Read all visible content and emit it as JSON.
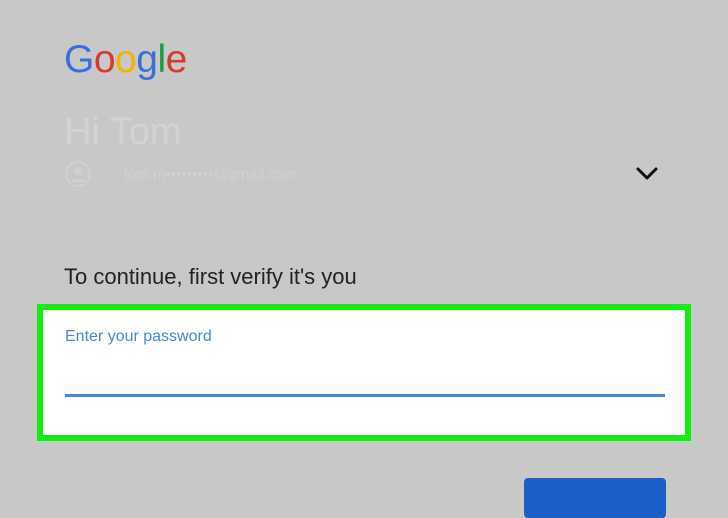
{
  "brand": {
    "logo_letters": [
      {
        "char": "G",
        "color": "#3a6fd9"
      },
      {
        "char": "o",
        "color": "#d93a2b"
      },
      {
        "char": "o",
        "color": "#f2b400"
      },
      {
        "char": "g",
        "color": "#3a6fd9"
      },
      {
        "char": "l",
        "color": "#179b46"
      },
      {
        "char": "e",
        "color": "#d93a2b"
      }
    ]
  },
  "account": {
    "greeting": "Hi Tom",
    "email": "tom.m•••••••••@gmail.com",
    "avatar_icon": "account-circle-icon",
    "switch_icon": "chevron-down-icon"
  },
  "verify": {
    "prompt": "To continue, first verify it's you",
    "password_label": "Enter your password",
    "password_value": ""
  },
  "colors": {
    "background": "#c8c8c8",
    "highlight": "#11ee11",
    "accent": "#4a86d8",
    "button": "#1a5fc6"
  }
}
